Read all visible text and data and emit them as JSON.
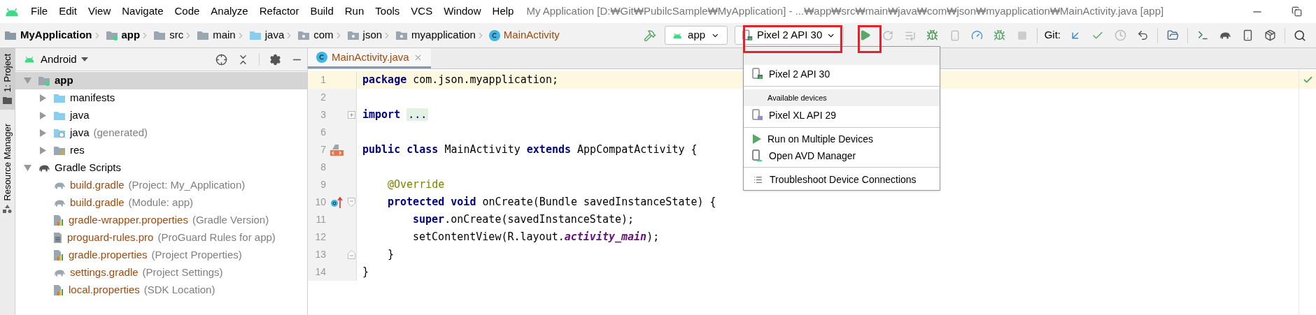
{
  "menu_bar": {
    "items": [
      "File",
      "Edit",
      "View",
      "Navigate",
      "Code",
      "Analyze",
      "Refactor",
      "Build",
      "Run",
      "Tools",
      "VCS",
      "Window",
      "Help"
    ],
    "window_title": "My Application [D:₩Git₩PubilcSample₩MyApplication] - ...₩app₩src₩main₩java₩com₩json₩myapplication₩MainActivity.java [app]"
  },
  "breadcrumbs": [
    {
      "label": "MyApplication",
      "kind": "project"
    },
    {
      "label": "app",
      "kind": "module"
    },
    {
      "label": "src",
      "kind": "folder"
    },
    {
      "label": "main",
      "kind": "folder"
    },
    {
      "label": "java",
      "kind": "source"
    },
    {
      "label": "com",
      "kind": "package"
    },
    {
      "label": "json",
      "kind": "package"
    },
    {
      "label": "myapplication",
      "kind": "package"
    },
    {
      "label": "MainActivity",
      "kind": "class"
    }
  ],
  "toolbar": {
    "run_configuration": "app",
    "device": "Pixel 2 API 30",
    "vcs_label": "Git:"
  },
  "side_tabs": [
    {
      "label": "1: Project",
      "selected": true
    },
    {
      "label": "Resource Manager",
      "selected": false
    }
  ],
  "project_panel": {
    "view": "Android",
    "tree": [
      {
        "name": "app",
        "kind": "module",
        "expanded": true,
        "selected": true,
        "children": [
          {
            "name": "manifests",
            "kind": "folder",
            "expanded": false,
            "selected": false
          },
          {
            "name": "java",
            "kind": "folder",
            "expanded": false,
            "selected": false
          },
          {
            "name": "java",
            "hint": "(generated)",
            "kind": "generated",
            "expanded": false,
            "selected": false
          },
          {
            "name": "res",
            "kind": "res",
            "expanded": false,
            "selected": false
          }
        ]
      },
      {
        "name": "Gradle Scripts",
        "kind": "gradle-group",
        "expanded": true,
        "selected": false,
        "children": [
          {
            "name": "build.gradle",
            "hint": "(Project: My_Application)",
            "kind": "gradle",
            "unversioned": true,
            "selected": false
          },
          {
            "name": "build.gradle",
            "hint": "(Module: app)",
            "kind": "gradle",
            "unversioned": true,
            "selected": false
          },
          {
            "name": "gradle-wrapper.properties",
            "hint": "(Gradle Version)",
            "kind": "properties",
            "unversioned": true,
            "selected": false
          },
          {
            "name": "proguard-rules.pro",
            "hint": "(ProGuard Rules for app)",
            "kind": "text",
            "unversioned": true,
            "selected": false
          },
          {
            "name": "gradle.properties",
            "hint": "(Project Properties)",
            "kind": "properties",
            "unversioned": true,
            "selected": false
          },
          {
            "name": "settings.gradle",
            "hint": "(Project Settings)",
            "kind": "gradle",
            "unversioned": true,
            "selected": false
          },
          {
            "name": "local.properties",
            "hint": "(SDK Location)",
            "kind": "properties",
            "unversioned": true,
            "selected": false
          }
        ]
      }
    ]
  },
  "editor": {
    "tabs": [
      {
        "label": "MainActivity.java",
        "selected": true
      }
    ],
    "lines": [
      {
        "number": "1",
        "current": true,
        "tokens": [
          {
            "kind": "keyword",
            "text": "package"
          },
          {
            "kind": "plain",
            "text": " com.json.myapplication;"
          }
        ]
      },
      {
        "number": "2",
        "current": false
      },
      {
        "number": "3",
        "current": false,
        "fold": {
          "kind": "collapsed"
        },
        "tokens": [
          {
            "kind": "keyword",
            "text": "import "
          },
          {
            "kind": "folded",
            "text": "..."
          }
        ]
      },
      {
        "number": "6",
        "current": false
      },
      {
        "number": "7",
        "current": false,
        "gutter": {
          "kind": "layout"
        },
        "tokens": [
          {
            "kind": "keyword",
            "text": "public class"
          },
          {
            "kind": "plain",
            "text": " MainActivity "
          },
          {
            "kind": "keyword",
            "text": "extends"
          },
          {
            "kind": "plain",
            "text": " AppCompatActivity {"
          }
        ]
      },
      {
        "number": "8",
        "current": false
      },
      {
        "number": "9",
        "current": false,
        "indent": {
          "kind": "member"
        },
        "tokens": [
          {
            "kind": "annotation",
            "text": "@Override"
          }
        ]
      },
      {
        "number": "10",
        "current": false,
        "indent": {
          "kind": "member"
        },
        "gutter": {
          "kind": "override"
        },
        "fold": {
          "kind": "start"
        },
        "tokens": [
          {
            "kind": "keyword",
            "text": "protected void"
          },
          {
            "kind": "plain",
            "text": " onCreate(Bundle savedInstanceState) {"
          }
        ]
      },
      {
        "number": "11",
        "current": false,
        "indent": {
          "kind": "body"
        },
        "tokens": [
          {
            "kind": "keyword",
            "text": "super"
          },
          {
            "kind": "plain",
            "text": ".onCreate(savedInstanceState);"
          }
        ]
      },
      {
        "number": "12",
        "current": false,
        "indent": {
          "kind": "body"
        },
        "tokens": [
          {
            "kind": "plain",
            "text": "setContentView(R.layout."
          },
          {
            "kind": "field",
            "text": "activity_main"
          },
          {
            "kind": "plain",
            "text": ");"
          }
        ]
      },
      {
        "number": "13",
        "current": false,
        "indent": {
          "kind": "member"
        },
        "fold": {
          "kind": "end"
        },
        "tokens": [
          {
            "kind": "plain",
            "text": "}"
          }
        ]
      },
      {
        "number": "14",
        "current": false,
        "tokens": [
          {
            "kind": "plain",
            "text": "}"
          }
        ]
      }
    ]
  },
  "device_menu": {
    "rows": [
      {
        "kind": "blank-header"
      },
      {
        "kind": "device",
        "label": "Pixel 2 API 30",
        "running": true
      },
      {
        "kind": "divider"
      },
      {
        "kind": "header",
        "label": "Available devices"
      },
      {
        "kind": "device",
        "label": "Pixel XL API 29",
        "running": false
      },
      {
        "kind": "divider"
      },
      {
        "kind": "run-multiple",
        "label": "Run on Multiple Devices"
      },
      {
        "kind": "avd",
        "label": "Open AVD Manager"
      },
      {
        "kind": "divider"
      },
      {
        "kind": "troubleshoot",
        "label": "Troubleshoot Device Connections"
      }
    ]
  }
}
